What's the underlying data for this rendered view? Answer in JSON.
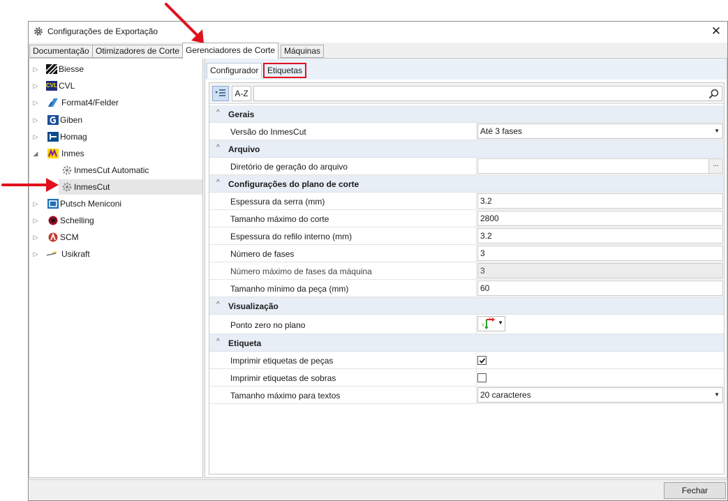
{
  "window": {
    "title": "Configurações de Exportação"
  },
  "tabs": [
    {
      "label": "Documentação"
    },
    {
      "label": "Otimizadores de Corte"
    },
    {
      "label": "Gerenciadores de Corte"
    },
    {
      "label": "Máquinas"
    }
  ],
  "tree": [
    {
      "label": "Biesse"
    },
    {
      "label": "CVL"
    },
    {
      "label": "Format4/Felder"
    },
    {
      "label": "Giben"
    },
    {
      "label": "Homag"
    },
    {
      "label": "Inmes"
    },
    {
      "label": "InmesCut Automatic"
    },
    {
      "label": "InmesCut"
    },
    {
      "label": "Putsch Meniconi"
    },
    {
      "label": "Schelling"
    },
    {
      "label": "SCM"
    },
    {
      "label": "Usikraft"
    }
  ],
  "icons": {
    "cvl_text": "CVL"
  },
  "subtabs": [
    {
      "label": "Configurador"
    },
    {
      "label": "Etiquetas"
    }
  ],
  "toolbar": {
    "az_label": "A-Z"
  },
  "grid": {
    "gerais": {
      "title": "Gerais",
      "versao": {
        "label": "Versão do InmesCut",
        "value": "Até 3 fases"
      }
    },
    "arquivo": {
      "title": "Arquivo",
      "diretorio": {
        "label": "Diretório de geração do arquivo",
        "value": "",
        "button": "..."
      }
    },
    "plano": {
      "title": "Configurações do plano de corte",
      "espessura_serra": {
        "label": "Espessura da serra (mm)",
        "value": "3.2"
      },
      "tamanho_max_corte": {
        "label": "Tamanho máximo do corte",
        "value": "2800"
      },
      "espessura_refilo": {
        "label": "Espessura do refilo interno (mm)",
        "value": "3.2"
      },
      "numero_fases": {
        "label": "Número de fases",
        "value": "3"
      },
      "numero_max_fases": {
        "label": "Número máximo de fases da máquina",
        "value": "3"
      },
      "tamanho_min_peca": {
        "label": "Tamanho mínimo da peça (mm)",
        "value": "60"
      }
    },
    "visualizacao": {
      "title": "Visualização",
      "ponto_zero": {
        "label": "Ponto zero no plano",
        "axis_x": "X",
        "axis_y": "Y"
      }
    },
    "etiqueta": {
      "title": "Etiqueta",
      "imprimir_pecas": {
        "label": "Imprimir etiquetas de peças",
        "checked": true
      },
      "imprimir_sobras": {
        "label": "Imprimir etiquetas de sobras",
        "checked": false
      },
      "tamanho_max_textos": {
        "label": "Tamanho máximo para textos",
        "value": "20 caracteres"
      }
    }
  },
  "footer": {
    "close_label": "Fechar"
  },
  "colors": {
    "annotation_red": "#e0101e",
    "category_bg": "#e8eef6"
  }
}
